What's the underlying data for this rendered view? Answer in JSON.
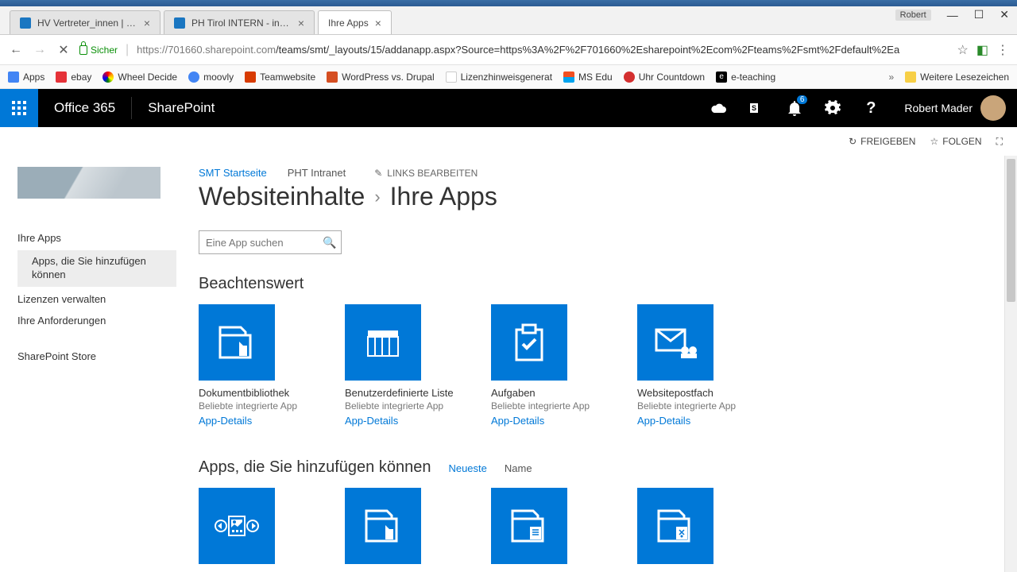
{
  "win": {
    "userbadge": "Robert"
  },
  "tabs": [
    {
      "title": "HV Vertreter_innen | Pä…"
    },
    {
      "title": "PH Tirol INTERN - intern"
    },
    {
      "title": "Ihre Apps",
      "active": true
    }
  ],
  "url": {
    "secure_label": "Sicher",
    "host": "https://701660.sharepoint.com",
    "path": "/teams/smt/_layouts/15/addanapp.aspx?Source=https%3A%2F%2F701660%2Esharepoint%2Ecom%2Fteams%2Fsmt%2Fdefault%2Ea"
  },
  "bookmarks": {
    "apps": "Apps",
    "items": [
      "ebay",
      "Wheel Decide",
      "moovly",
      "Teamwebsite",
      "WordPress vs. Drupal",
      "Lizenzhinweisgenerat",
      "MS Edu",
      "Uhr Countdown",
      "e-teaching"
    ],
    "more": "Weitere Lesezeichen"
  },
  "suite": {
    "o365": "Office 365",
    "app": "SharePoint",
    "notif_count": "6",
    "user": "Robert Mader"
  },
  "cmds": {
    "share": "FREIGEBEN",
    "follow": "FOLGEN"
  },
  "topnav": {
    "link1": "SMT Startseite",
    "link2": "PHT Intranet",
    "edit": "LINKS BEARBEITEN"
  },
  "breadcrumb": {
    "a": "Websiteinhalte",
    "b": "Ihre Apps"
  },
  "search": {
    "placeholder": "Eine App suchen"
  },
  "leftnav": {
    "n1": "Ihre Apps",
    "n1a": "Apps, die Sie hinzufügen können",
    "n2": "Lizenzen verwalten",
    "n3": "Ihre Anforderungen",
    "n4": "SharePoint Store"
  },
  "sect1": {
    "title": "Beachtenswert",
    "tiles": [
      {
        "title": "Dokumentbibliothek",
        "sub": "Beliebte integrierte App",
        "details": "App-Details"
      },
      {
        "title": "Benutzerdefinierte Liste",
        "sub": "Beliebte integrierte App",
        "details": "App-Details"
      },
      {
        "title": "Aufgaben",
        "sub": "Beliebte integrierte App",
        "details": "App-Details"
      },
      {
        "title": "Websitepostfach",
        "sub": "Beliebte integrierte App",
        "details": "App-Details"
      }
    ]
  },
  "sect2": {
    "title": "Apps, die Sie hinzufügen können",
    "filters": {
      "a": "Neueste",
      "b": "Name"
    }
  }
}
